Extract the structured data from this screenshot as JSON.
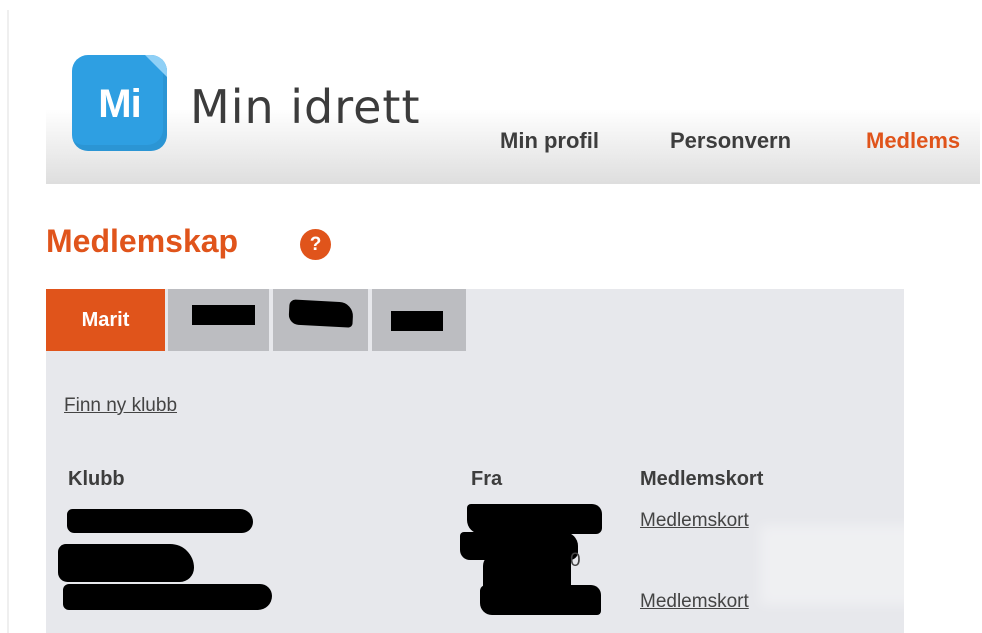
{
  "brand": {
    "logo_text": "Mi",
    "title": "Min idrett",
    "logo_color": "#2e9fe2"
  },
  "nav": {
    "items": [
      "Min profil",
      "Personvern",
      "Medlems"
    ]
  },
  "accent_color": "#e0541b",
  "page": {
    "title": "Medlemskap",
    "help_icon": "?"
  },
  "tabs": {
    "active": "Marit"
  },
  "find_club_link": "Finn ny klubb",
  "table": {
    "headers": {
      "club": "Klubb",
      "from": "Fra",
      "card": "Medlemskort"
    },
    "rows": [
      {
        "card": "Medlemskort"
      },
      {
        "from_partial": "0"
      },
      {
        "card": "Medlemskort"
      }
    ]
  }
}
